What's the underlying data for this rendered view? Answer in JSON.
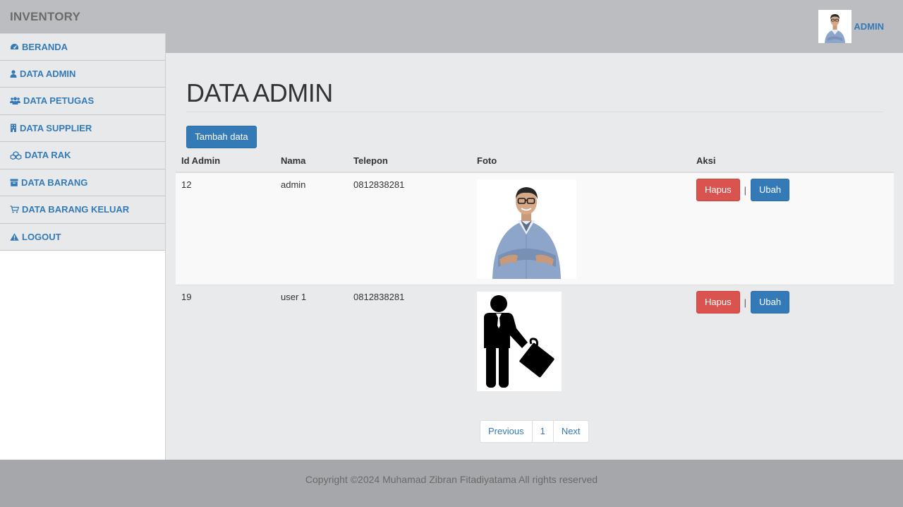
{
  "header": {
    "brand": "INVENTORY",
    "user_name": "ADMIN"
  },
  "sidebar": {
    "items": [
      {
        "label": "BERANDA",
        "icon": "dashboard-icon"
      },
      {
        "label": "DATA ADMIN",
        "icon": "user-icon"
      },
      {
        "label": "DATA PETUGAS",
        "icon": "users-icon"
      },
      {
        "label": "DATA SUPPLIER",
        "icon": "building-icon"
      },
      {
        "label": "DATA RAK",
        "icon": "cubes-icon"
      },
      {
        "label": "DATA BARANG",
        "icon": "archive-icon"
      },
      {
        "label": "DATA BARANG KELUAR",
        "icon": "cart-icon"
      },
      {
        "label": "LOGOUT",
        "icon": "warning-icon"
      }
    ]
  },
  "main": {
    "title": "DATA ADMIN",
    "add_button": "Tambah data",
    "table": {
      "headers": [
        "Id Admin",
        "Nama",
        "Telepon",
        "Foto",
        "Aksi"
      ],
      "rows": [
        {
          "id": "12",
          "nama": "admin",
          "telepon": "0812838281",
          "foto": "person-photo",
          "delete": "Hapus",
          "sep": "|",
          "edit": "Ubah"
        },
        {
          "id": "19",
          "nama": "user 1",
          "telepon": "0812838281",
          "foto": "businessman-silhouette",
          "delete": "Hapus",
          "sep": "|",
          "edit": "Ubah"
        }
      ]
    },
    "pagination": {
      "previous": "Previous",
      "page": "1",
      "next": "Next"
    }
  },
  "footer": {
    "text": "Copyright ©2024 Muhamad Zibran Fitadiyatama All rights reserved"
  },
  "colors": {
    "primary": "#337ab7",
    "danger": "#d9534f",
    "topbar": "#bcbdc0",
    "footer": "#a6a7aa"
  }
}
